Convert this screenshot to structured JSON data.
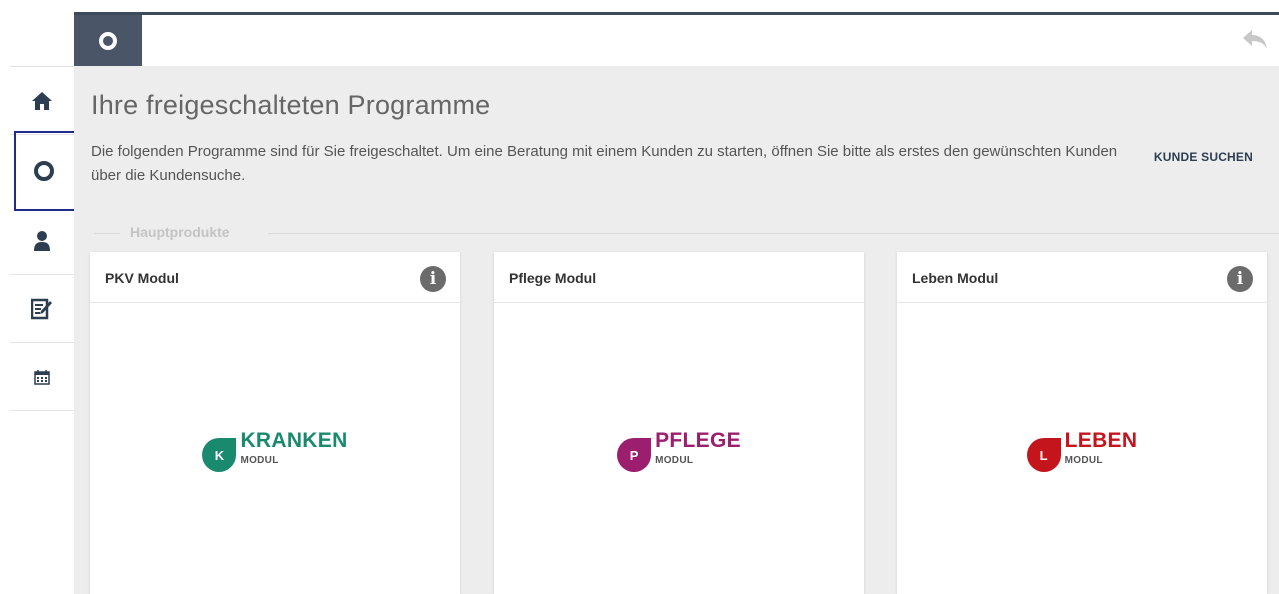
{
  "topbar": {
    "logo_icon": "o-ring-logo-icon",
    "back_icon": "reply-arrow-icon"
  },
  "sidebar": {
    "items": [
      {
        "icon": "home-icon"
      },
      {
        "icon": "o-ring-logo-icon",
        "active": true
      },
      {
        "icon": "user-icon"
      },
      {
        "icon": "edit-document-icon"
      },
      {
        "icon": "calendar-icon"
      }
    ]
  },
  "main": {
    "title": "Ihre freigeschalteten Programme",
    "intro": "Die folgenden Programme sind für Sie freigeschaltet. Um eine Beratung mit einem Kunden zu starten, öffnen Sie bitte als erstes den gewünschten Kunden über die Kundensuche.",
    "kunde_suchen": "KUNDE SUCHEN",
    "section_label": "Hauptprodukte"
  },
  "cards": [
    {
      "title": "PKV Modul",
      "letter": "K",
      "name": "KRANKEN",
      "sub": "MODUL",
      "color": "#1a8a6e",
      "has_info": true
    },
    {
      "title": "Pflege Modul",
      "letter": "P",
      "name": "PFLEGE",
      "sub": "MODUL",
      "color": "#9b1f6e",
      "has_info": false
    },
    {
      "title": "Leben Modul",
      "letter": "L",
      "name": "LEBEN",
      "sub": "MODUL",
      "color": "#c4151c",
      "has_info": true
    }
  ],
  "colors": {
    "topbar_border": "#3d4a5c",
    "active_outline": "#1f2a8a",
    "content_bg": "#ededed"
  }
}
